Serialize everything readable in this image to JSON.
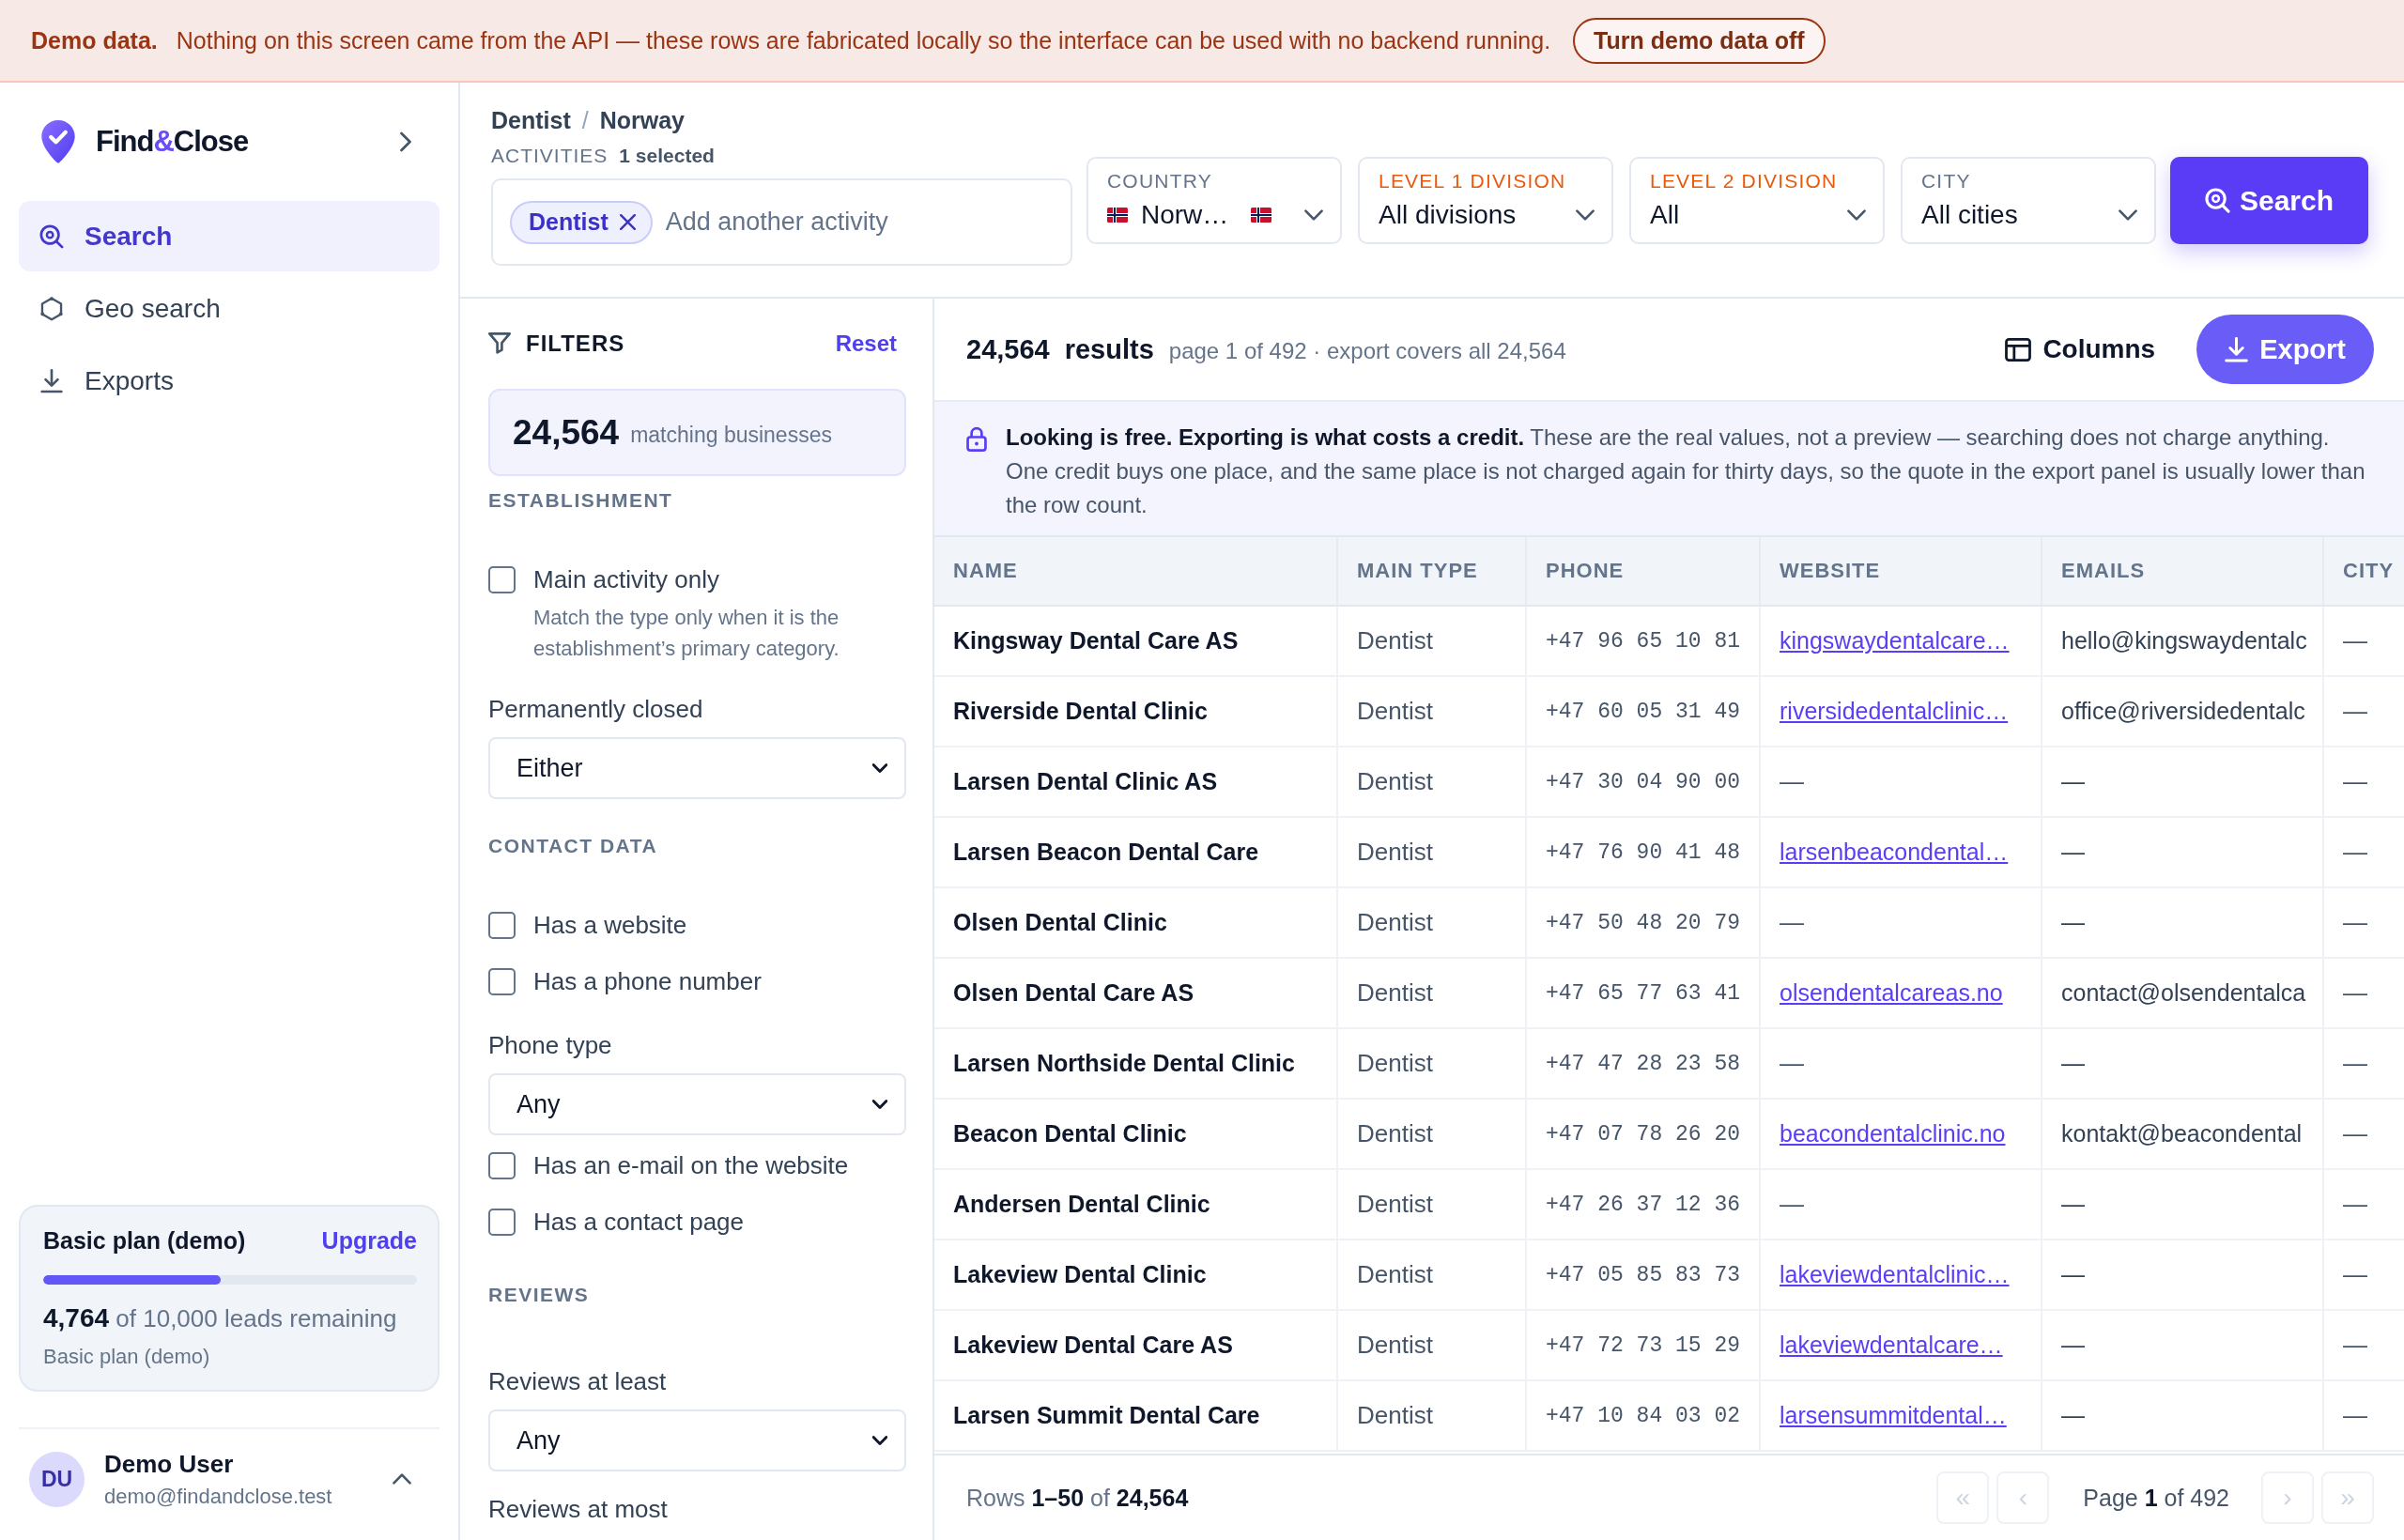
{
  "demo_banner": {
    "title": "Demo data.",
    "message": "Nothing on this screen came from the API — these rows are fabricated locally so the interface can be used with no backend running.",
    "button": "Turn demo data off"
  },
  "sidebar": {
    "brand": [
      {
        "text": "Find",
        "accent": false
      },
      {
        "text": "&",
        "accent": true
      },
      {
        "text": "Close",
        "accent": false
      }
    ],
    "nav": [
      {
        "kind": "search",
        "label": "Search",
        "selected": true
      },
      {
        "kind": "geo",
        "label": "Geo search",
        "selected": false
      },
      {
        "kind": "exports",
        "label": "Exports",
        "selected": false
      }
    ],
    "plan": {
      "title": "Basic plan (demo)",
      "action": "Upgrade",
      "level": 0.476,
      "remaining": "**4,764** of 10,000 leads remaining",
      "caption": "Basic plan (demo)"
    },
    "user": {
      "initials": "DU",
      "name": "Demo User",
      "email": "demo@findandclose.test"
    }
  },
  "search_bar": {
    "breadcrumb": [
      "Dentist",
      "Norway"
    ],
    "breadcrumb_separator": "/",
    "activities": {
      "label": "ACTIVITIES",
      "count": "1 selected",
      "chips": [
        "Dentist"
      ],
      "placeholder": "Add another activity"
    },
    "dropdowns": [
      {
        "kind": "country",
        "label": "COUNTRY",
        "value": "Norw…",
        "highlighted": false
      },
      {
        "kind": "plain",
        "label": "LEVEL 1 DIVISION",
        "value": "All divisions",
        "highlighted": true
      },
      {
        "kind": "plain",
        "label": "LEVEL 2 DIVISION",
        "value": "All",
        "highlighted": true
      },
      {
        "kind": "plain",
        "label": "CITY",
        "value": "All cities",
        "highlighted": false
      }
    ],
    "button": "Search"
  },
  "filters": {
    "title": "FILTERS",
    "reset": "Reset",
    "count": "24,564",
    "count_label": "matching businesses",
    "sections": [
      {
        "heading": "ESTABLISHMENT",
        "items": [
          {
            "kind": "checkbox",
            "label": "Main activity only",
            "checked": false,
            "description": "Match the type only when it is the establishment’s primary category."
          },
          {
            "kind": "select",
            "label": "Permanently closed",
            "value": "Either"
          }
        ]
      },
      {
        "heading": "CONTACT DATA",
        "items": [
          {
            "kind": "checkbox",
            "label": "Has a website",
            "checked": false
          },
          {
            "kind": "checkbox",
            "label": "Has a phone number",
            "checked": false
          },
          {
            "kind": "select",
            "label": "Phone type",
            "value": "Any"
          },
          {
            "kind": "checkbox",
            "label": "Has an e-mail on the website",
            "checked": false
          },
          {
            "kind": "checkbox",
            "label": "Has a contact page",
            "checked": false
          }
        ]
      },
      {
        "heading": "REVIEWS",
        "items": [
          {
            "kind": "select",
            "label": "Reviews at least",
            "value": "Any"
          },
          {
            "kind": "select",
            "label": "Reviews at most"
          }
        ]
      }
    ]
  },
  "results": {
    "count": "24,564",
    "label": "results",
    "summary": "page 1 of 492 · export covers all 24,564",
    "columns_button": "Columns",
    "export_button": "Export",
    "notice": "**Looking is free. Exporting is what costs a credit.** These are the real values, not a preview — searching does not charge anything. One credit buys one place, and the same place is not charged again for thirty days, so the quote in the export panel is usually lower than the row count.",
    "table": {
      "columns": [
        "NAME",
        "MAIN TYPE",
        "PHONE",
        "WEBSITE",
        "EMAILS",
        "CITY"
      ],
      "rows": [
        {
          "name": "Kingsway Dental Care AS",
          "main_type": "Dentist",
          "phone": "+47 96 65 10 81",
          "website": {
            "text": "kingswaydentalcare…",
            "link": true
          },
          "emails": "hello@kingswaydentalc",
          "city": "—"
        },
        {
          "name": "Riverside Dental Clinic",
          "main_type": "Dentist",
          "phone": "+47 60 05 31 49",
          "website": {
            "text": "riversidedentalclinic…",
            "link": true
          },
          "emails": "office@riversidedentalc",
          "city": "—"
        },
        {
          "name": "Larsen Dental Clinic AS",
          "main_type": "Dentist",
          "phone": "+47 30 04 90 00",
          "website": {
            "text": "—",
            "link": false
          },
          "emails": "—",
          "city": "—"
        },
        {
          "name": "Larsen Beacon Dental Care",
          "main_type": "Dentist",
          "phone": "+47 76 90 41 48",
          "website": {
            "text": "larsenbeacondental…",
            "link": true
          },
          "emails": "—",
          "city": "—"
        },
        {
          "name": "Olsen Dental Clinic",
          "main_type": "Dentist",
          "phone": "+47 50 48 20 79",
          "website": {
            "text": "—",
            "link": false
          },
          "emails": "—",
          "city": "—"
        },
        {
          "name": "Olsen Dental Care AS",
          "main_type": "Dentist",
          "phone": "+47 65 77 63 41",
          "website": {
            "text": "olsendentalcareas.no",
            "link": true
          },
          "emails": "contact@olsendentalca",
          "city": "—"
        },
        {
          "name": "Larsen Northside Dental Clinic",
          "main_type": "Dentist",
          "phone": "+47 47 28 23 58",
          "website": {
            "text": "—",
            "link": false
          },
          "emails": "—",
          "city": "—"
        },
        {
          "name": "Beacon Dental Clinic",
          "main_type": "Dentist",
          "phone": "+47 07 78 26 20",
          "website": {
            "text": "beacondentalclinic.no",
            "link": true
          },
          "emails": "kontakt@beacondental",
          "city": "—"
        },
        {
          "name": "Andersen Dental Clinic",
          "main_type": "Dentist",
          "phone": "+47 26 37 12 36",
          "website": {
            "text": "—",
            "link": false
          },
          "emails": "—",
          "city": "—"
        },
        {
          "name": "Lakeview Dental Clinic",
          "main_type": "Dentist",
          "phone": "+47 05 85 83 73",
          "website": {
            "text": "lakeviewdentalclinic…",
            "link": true
          },
          "emails": "—",
          "city": "—"
        },
        {
          "name": "Lakeview Dental Care AS",
          "main_type": "Dentist",
          "phone": "+47 72 73 15 29",
          "website": {
            "text": "lakeviewdentalcare…",
            "link": true
          },
          "emails": "—",
          "city": "—"
        },
        {
          "name": "Larsen Summit Dental Care",
          "main_type": "Dentist",
          "phone": "+47 10 84 03 02",
          "website": {
            "text": "larsensummitdental…",
            "link": true
          },
          "emails": "—",
          "city": "—"
        }
      ]
    },
    "footer": {
      "rows": "Rows **1–50** of **24,564**",
      "page": "Page **1** of 492",
      "buttons": [
        "«",
        "‹",
        "›",
        "»"
      ]
    }
  }
}
